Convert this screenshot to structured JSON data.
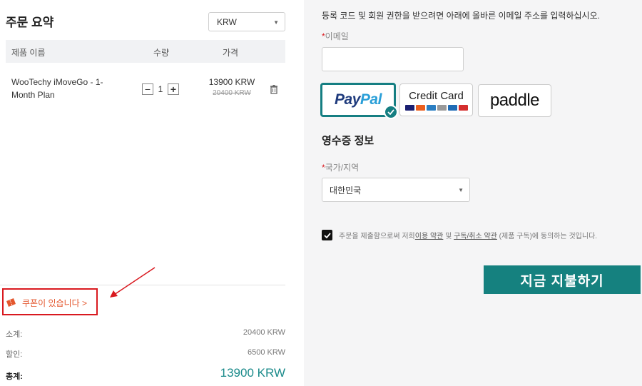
{
  "summary": {
    "title": "주문 요약",
    "currency": "KRW",
    "columns": {
      "name": "제품 이름",
      "qty": "수량",
      "price": "가격"
    },
    "item": {
      "name": "WooTechy iMoveGo - 1-Month Plan",
      "qty": "1",
      "price": "13900 KRW",
      "old_price": "20400 KRW"
    },
    "coupon_label": "쿠폰이 있습니다 >",
    "subtotal_label": "소계:",
    "subtotal_value": "20400 KRW",
    "discount_label": "할인:",
    "discount_value": "6500 KRW",
    "total_label": "총계:",
    "total_value": "13900 KRW"
  },
  "checkout": {
    "notice": "등록 코드 및 회원 권한을 받으려면 아래에 올바른 이메일 주소를 입력하십시오.",
    "email_label": "이메일",
    "email_value": "",
    "payment_methods": {
      "paypal_a": "Pay",
      "paypal_b": "Pal",
      "card": "Credit Card",
      "paddle": "paddle"
    },
    "selected_payment": "PayPal",
    "receipt_title": "영수증 정보",
    "country_label": "국가/지역",
    "country_value": "대한민국",
    "agree_prefix": "주문을 제출함으로써 저희 ",
    "terms_link": "이용 약관",
    "agree_mid": " 및 ",
    "cancel_link": "구독/취소 약관",
    "agree_suffix": " (제품 구독)에 동의하는 것입니다.",
    "agree_checked": true,
    "pay_button": "지금 지불하기"
  },
  "colors": {
    "accent": "#15817f",
    "required": "#d9191f",
    "coupon": "#e4572e",
    "annotation": "#d9191f"
  }
}
